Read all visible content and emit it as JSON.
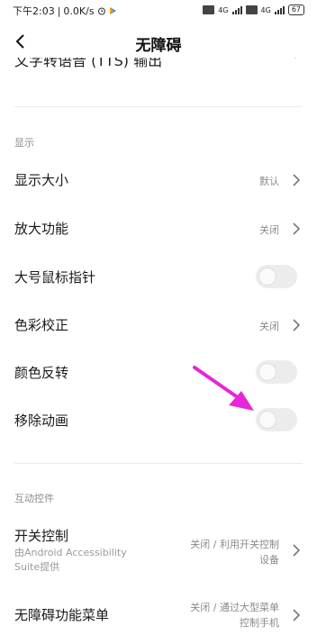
{
  "status_bar": {
    "time": "下午2:03",
    "net_speed": "0.0K/s",
    "network_tag_1": "4G",
    "network_tag_2": "4G",
    "battery": "67"
  },
  "header": {
    "title": "无障碍"
  },
  "cut_off_row": {
    "label": "文字转语音 (TTS) 输出"
  },
  "sections": {
    "display": {
      "heading": "显示",
      "rows": [
        {
          "label": "显示大小",
          "value": "默认",
          "type": "nav"
        },
        {
          "label": "放大功能",
          "value": "关闭",
          "type": "nav"
        },
        {
          "label": "大号鼠标指针",
          "type": "toggle",
          "on": false
        },
        {
          "label": "色彩校正",
          "value": "关闭",
          "type": "nav"
        },
        {
          "label": "颜色反转",
          "type": "toggle",
          "on": false
        },
        {
          "label": "移除动画",
          "type": "toggle",
          "on": false
        }
      ]
    },
    "interaction": {
      "heading": "互动控件",
      "rows": [
        {
          "label": "开关控制",
          "subtitle_line1": "由Android Accessibility",
          "subtitle_line2": "Suite提供",
          "value_line1": "关闭 / 利用开关控制",
          "value_line2": "设备",
          "type": "nav"
        },
        {
          "label": "无障碍功能菜单",
          "value_line1": "关闭 / 通过大型菜单",
          "value_line2": "控制手机",
          "type": "nav"
        }
      ]
    }
  },
  "colors": {
    "annotation_arrow": "#e626d8",
    "toggle_off": "#ececec",
    "secondary_text": "#8a8a8a"
  }
}
